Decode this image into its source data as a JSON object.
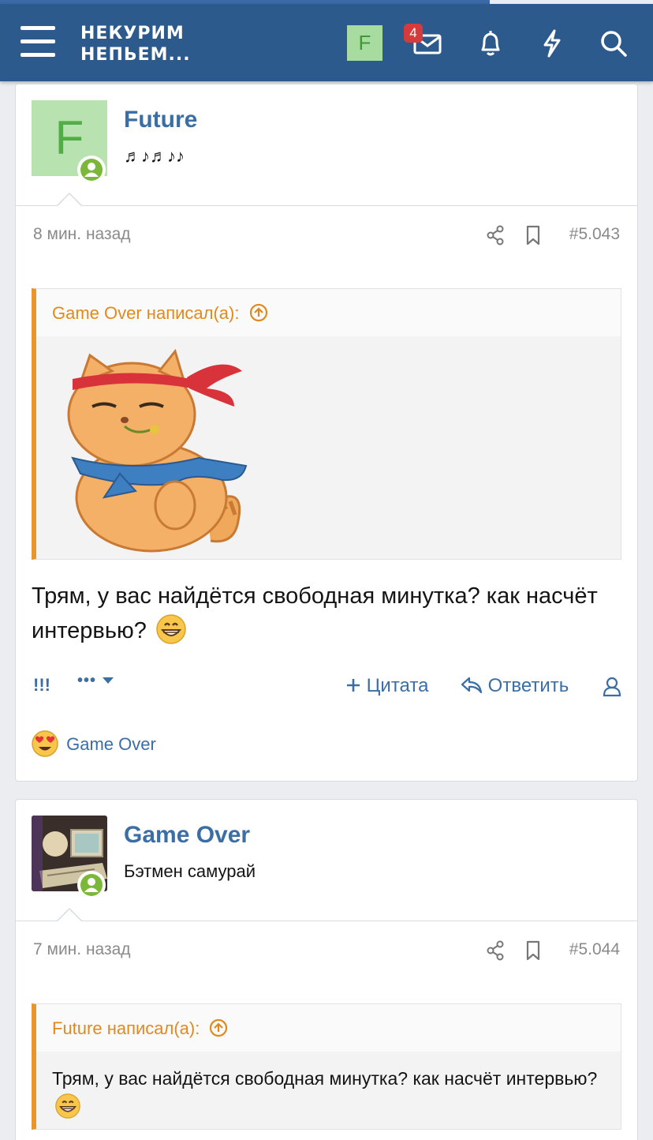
{
  "header": {
    "logo_line1": "НЕКУРИМ",
    "logo_line2": "НЕПЬЕМ...",
    "avatar_letter": "F",
    "inbox_badge": "4",
    "icons": [
      "menu-icon",
      "inbox-icon",
      "bell-icon",
      "lightning-icon",
      "search-icon"
    ],
    "scroll_progress": 0.75,
    "brand_color": "#2d5a8c"
  },
  "posts": [
    {
      "username": "Future",
      "user_title": "♬♪♬♪♪",
      "avatar_letter": "F",
      "time": "8 мин. назад",
      "number": "#5.043",
      "quote": {
        "author_line": "Game Over написал(а):",
        "content": "sticker-cat-headband"
      },
      "message": "Трям, у вас найдётся свободная минутка? как насчёт интервью?",
      "actions": {
        "report": "!!!",
        "more": "•••",
        "quote": "Цитата",
        "reply": "Ответить"
      },
      "reactions": {
        "user": "Game Over",
        "emoji": "heart-eyes"
      }
    },
    {
      "username": "Game Over",
      "user_title": "Бэтмен самурай",
      "time": "7 мин. назад",
      "number": "#5.044",
      "quote": {
        "author_line": "Future написал(а):",
        "content": "Трям, у вас найдётся свободная минутка? как насчёт интервью?"
      }
    }
  ],
  "colors": {
    "accent": "#3a6ea5",
    "quote_border": "#e8962b",
    "online": "#7bb83a"
  }
}
